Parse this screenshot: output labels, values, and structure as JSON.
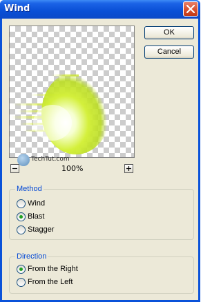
{
  "window": {
    "title": "Wind"
  },
  "preview": {
    "zoom_label": "100%",
    "watermark": "TechTut.com"
  },
  "buttons": {
    "ok": "OK",
    "cancel": "Cancel"
  },
  "method": {
    "legend": "Method",
    "options": [
      {
        "label": "Wind",
        "checked": false
      },
      {
        "label": "Blast",
        "checked": true
      },
      {
        "label": "Stagger",
        "checked": false
      }
    ]
  },
  "direction": {
    "legend": "Direction",
    "options": [
      {
        "label": "From the Right",
        "checked": true
      },
      {
        "label": "From the Left",
        "checked": false
      }
    ]
  },
  "colors": {
    "titlebar": "#0a52d9",
    "dialog_bg": "#ece9d8",
    "legend_text": "#0046d5",
    "radio_check": "#21a121"
  },
  "icons": {
    "close": "close-icon",
    "zoom_out": "minus-icon",
    "zoom_in": "plus-icon"
  }
}
